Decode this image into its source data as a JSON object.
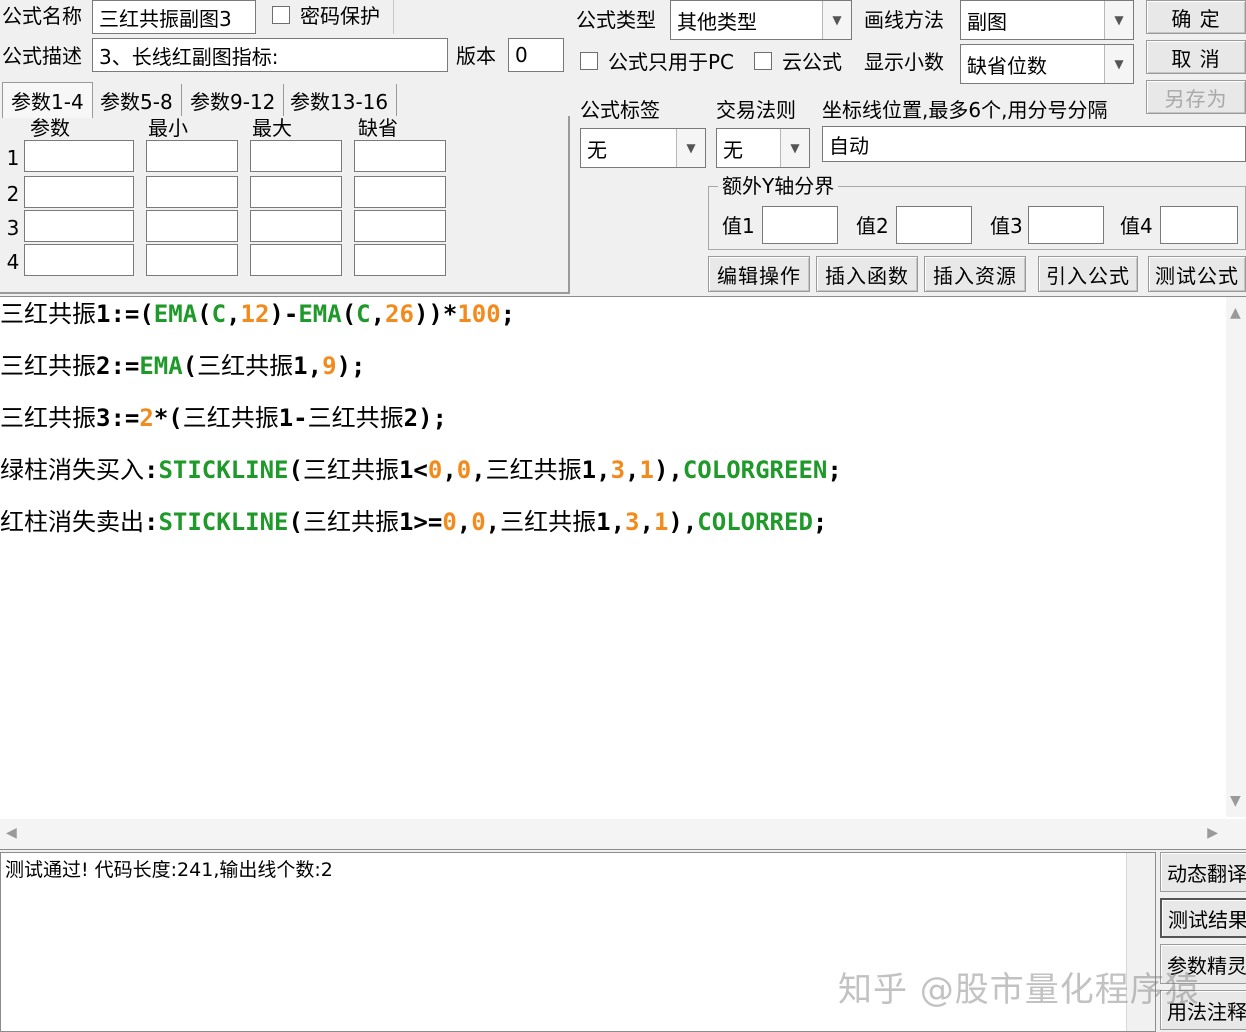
{
  "header": {
    "name_label": "公式名称",
    "name_value": "三红共振副图3",
    "password_label": "密码保护",
    "desc_label": "公式描述",
    "desc_value": "3、长线红副图指标:",
    "version_label": "版本",
    "version_value": "0",
    "type_label": "公式类型",
    "type_value": "其他类型",
    "draw_label": "画线方法",
    "draw_value": "副图",
    "pc_only_label": "公式只用于PC",
    "cloud_label": "云公式",
    "decimal_label": "显示小数",
    "decimal_value": "缺省位数",
    "tag_label": "公式标签",
    "tag_value": "无",
    "rule_label": "交易法则",
    "rule_value": "无",
    "coord_label": "坐标线位置,最多6个,用分号分隔",
    "coord_value": "自动"
  },
  "buttons": {
    "ok": "确 定",
    "cancel": "取 消",
    "save_as": "另存为",
    "edit_ops": "编辑操作",
    "insert_func": "插入函数",
    "insert_res": "插入资源",
    "import_formula": "引入公式",
    "test_formula": "测试公式"
  },
  "tabs": [
    "参数1-4",
    "参数5-8",
    "参数9-12",
    "参数13-16"
  ],
  "params": {
    "headers": [
      "参数",
      "最小",
      "最大",
      "缺省"
    ],
    "rows": [
      "1",
      "2",
      "3",
      "4"
    ]
  },
  "yaxis": {
    "title": "额外Y轴分界",
    "labels": [
      "值1",
      "值2",
      "值3",
      "值4"
    ]
  },
  "code": [
    [
      {
        "t": "三红共振",
        "c": "black",
        "cjk": true
      },
      {
        "t": "1:=(",
        "c": "black"
      },
      {
        "t": "EMA",
        "c": "green"
      },
      {
        "t": "(",
        "c": "black"
      },
      {
        "t": "C",
        "c": "green"
      },
      {
        "t": ",",
        "c": "black"
      },
      {
        "t": "12",
        "c": "orange"
      },
      {
        "t": ")-",
        "c": "black"
      },
      {
        "t": "EMA",
        "c": "green"
      },
      {
        "t": "(",
        "c": "black"
      },
      {
        "t": "C",
        "c": "green"
      },
      {
        "t": ",",
        "c": "black"
      },
      {
        "t": "26",
        "c": "orange"
      },
      {
        "t": "))*",
        "c": "black"
      },
      {
        "t": "100",
        "c": "orange"
      },
      {
        "t": ";",
        "c": "black"
      }
    ],
    [
      {
        "t": "三红共振",
        "c": "black",
        "cjk": true
      },
      {
        "t": "2:=",
        "c": "black"
      },
      {
        "t": "EMA",
        "c": "green"
      },
      {
        "t": "(",
        "c": "black"
      },
      {
        "t": "三红共振",
        "c": "black",
        "cjk": true
      },
      {
        "t": "1,",
        "c": "black"
      },
      {
        "t": "9",
        "c": "orange"
      },
      {
        "t": ");",
        "c": "black"
      }
    ],
    [
      {
        "t": "三红共振",
        "c": "black",
        "cjk": true
      },
      {
        "t": "3:=",
        "c": "black"
      },
      {
        "t": "2",
        "c": "orange"
      },
      {
        "t": "*(",
        "c": "black"
      },
      {
        "t": "三红共振",
        "c": "black",
        "cjk": true
      },
      {
        "t": "1-",
        "c": "black"
      },
      {
        "t": "三红共振",
        "c": "black",
        "cjk": true
      },
      {
        "t": "2);",
        "c": "black"
      }
    ],
    [
      {
        "t": "绿柱消失买入",
        "c": "black",
        "cjk": true
      },
      {
        "t": ":",
        "c": "black"
      },
      {
        "t": "STICKLINE",
        "c": "green"
      },
      {
        "t": "(",
        "c": "black"
      },
      {
        "t": "三红共振",
        "c": "black",
        "cjk": true
      },
      {
        "t": "1<",
        "c": "black"
      },
      {
        "t": "0",
        "c": "orange"
      },
      {
        "t": ",",
        "c": "black"
      },
      {
        "t": "0",
        "c": "orange"
      },
      {
        "t": ",",
        "c": "black"
      },
      {
        "t": "三红共振",
        "c": "black",
        "cjk": true
      },
      {
        "t": "1,",
        "c": "black"
      },
      {
        "t": "3",
        "c": "orange"
      },
      {
        "t": ",",
        "c": "black"
      },
      {
        "t": "1",
        "c": "orange"
      },
      {
        "t": "),",
        "c": "black"
      },
      {
        "t": "COLORGREEN",
        "c": "green"
      },
      {
        "t": ";",
        "c": "black"
      }
    ],
    [
      {
        "t": "红柱消失卖出",
        "c": "black",
        "cjk": true
      },
      {
        "t": ":",
        "c": "black"
      },
      {
        "t": "STICKLINE",
        "c": "green"
      },
      {
        "t": "(",
        "c": "black"
      },
      {
        "t": "三红共振",
        "c": "black",
        "cjk": true
      },
      {
        "t": "1>=",
        "c": "black"
      },
      {
        "t": "0",
        "c": "orange"
      },
      {
        "t": ",",
        "c": "black"
      },
      {
        "t": "0",
        "c": "orange"
      },
      {
        "t": ",",
        "c": "black"
      },
      {
        "t": "三红共振",
        "c": "black",
        "cjk": true
      },
      {
        "t": "1,",
        "c": "black"
      },
      {
        "t": "3",
        "c": "orange"
      },
      {
        "t": ",",
        "c": "black"
      },
      {
        "t": "1",
        "c": "orange"
      },
      {
        "t": "),",
        "c": "black"
      },
      {
        "t": "COLORRED",
        "c": "green"
      },
      {
        "t": ";",
        "c": "black"
      }
    ]
  ],
  "output": {
    "message": "测试通过! 代码长度:241,输出线个数:2"
  },
  "side_buttons": [
    "动态翻译",
    "测试结果",
    "参数精灵",
    "用法注释"
  ],
  "watermark": "知乎 @股市量化程序猿",
  "colors": {
    "keyword": "#1f9a2a",
    "number": "#f28a1c",
    "text": "#000000"
  },
  "icons": {
    "dropdown": "chevron-down-icon",
    "scroll_up": "scroll-up-arrow-icon",
    "scroll_down": "scroll-down-arrow-icon",
    "scroll_left": "scroll-left-arrow-icon",
    "scroll_right": "scroll-right-arrow-icon"
  }
}
